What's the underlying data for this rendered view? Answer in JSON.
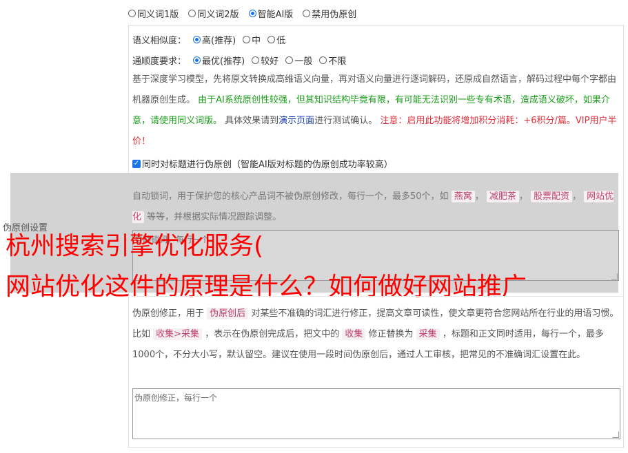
{
  "mode_options": [
    {
      "label": "同义词1版",
      "selected": false
    },
    {
      "label": "同义词2版",
      "selected": false
    },
    {
      "label": "智能AI版",
      "selected": true
    },
    {
      "label": "禁用伪原创",
      "selected": false
    }
  ],
  "similarity": {
    "label": "语义相似度：",
    "options": [
      {
        "label": "高(推荐)",
        "selected": true
      },
      {
        "label": "中",
        "selected": false
      },
      {
        "label": "低",
        "selected": false
      }
    ]
  },
  "fluency": {
    "label": "通顺度要求：",
    "options": [
      {
        "label": "最优(推荐)",
        "selected": true
      },
      {
        "label": "较好",
        "selected": false
      },
      {
        "label": "一般",
        "selected": false
      },
      {
        "label": "不限",
        "selected": false
      }
    ]
  },
  "ai_desc": {
    "p1": "基于深度学习模型，先将原文转换成高维语义向量，再对语义向量进行逐词解码，还原成自然语言，解码过程中每个字都由机器原创生成。",
    "green": "由于AI系统原创性较强，但其知识结构毕竟有限，有可能无法识别一些专有术语，造成语义破坏，如果介意，请使用同义词版。",
    "p2": "具体效果请到",
    "link": "演示页面",
    "p3": "进行测试确认。",
    "red": "注意：启用此功能将增加积分消耗：+6积分/篇。VIP用户半价！"
  },
  "title_checkbox": {
    "label": "同时对标题进行伪原创（智能AI版对标题的伪原创成功率较高）",
    "checked": true
  },
  "lock_words": {
    "pre": "自动锁词，用于保护您的核心产品词不被伪原创修改，每行一个，最多50个，如",
    "tags": [
      "燕窝",
      "减肥茶",
      "股票配资",
      "网站优化"
    ],
    "post": "等等，并根据实际情况跟踪调整。",
    "placeholder": "自动锁词，每行一个"
  },
  "side_label": "伪原创设置",
  "overlay_title_line1": "杭州搜索引擎优化服务(",
  "overlay_title_line2": "网站优化这件的原理是什么？如何做好网站推广",
  "correction": {
    "t1": "伪原创修正，用于",
    "tag1": "伪原创后",
    "t2": "对某些不准确的词汇进行修正，提高文章可读性，使文章更符合您网站所在行业的用语习惯。比如",
    "tag2": "收集>采集",
    "t3": "，表示在伪原创完成后，把文中的",
    "tag3": "收集",
    "t4": "修正替换为",
    "tag4": "采集",
    "t5": "，标题和正文同时适用，每行一个，最多1000个，不分大小写，默认留空。建议在使用一段时间伪原创后，通过人工审核，把常见的不准确词汇设置在此。",
    "placeholder": "伪原创修正，每行一个"
  },
  "accent_color": "#1a73e8"
}
